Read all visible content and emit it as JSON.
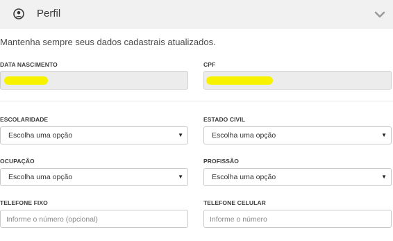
{
  "header": {
    "title": "Perfil",
    "icon": "user-circle-icon",
    "toggle_icon": "chevron-down-icon"
  },
  "intro": "Mantenha sempre seus dados cadastrais atualizados.",
  "fields": {
    "birth_date": {
      "label": "DATA NASCIMENTO"
    },
    "cpf": {
      "label": "CPF"
    },
    "education": {
      "label": "ESCOLARIDADE",
      "value": "Escolha uma opção"
    },
    "marital_status": {
      "label": "ESTADO CIVIL",
      "value": "Escolha uma opção"
    },
    "occupation": {
      "label": "OCUPAÇÃO",
      "value": "Escolha uma opção"
    },
    "profession": {
      "label": "PROFISSÃO",
      "value": "Escolha uma opção"
    },
    "landline": {
      "label": "TELEFONE FIXO",
      "placeholder": "Informe o número (opcional)"
    },
    "mobile": {
      "label": "TELEFONE CELULAR",
      "placeholder": "Informe o número"
    }
  },
  "colors": {
    "header_bg": "#f1f1f1",
    "redaction": "#f7f200",
    "readonly_bg": "#ececec"
  }
}
